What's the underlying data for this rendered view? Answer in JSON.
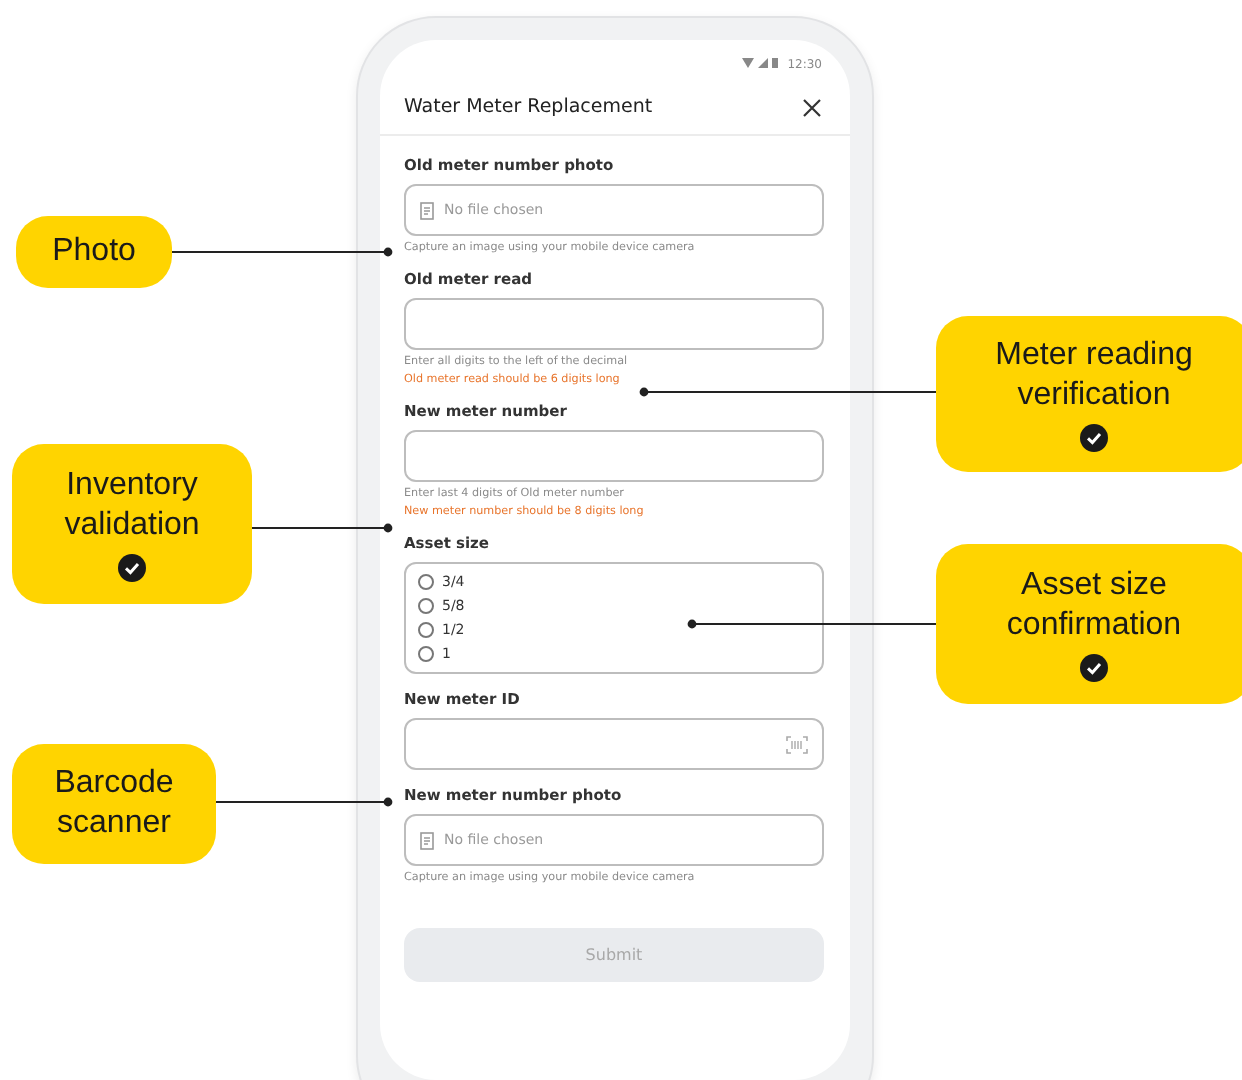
{
  "status_bar": {
    "time": "12:30"
  },
  "header": {
    "title": "Water Meter Replacement"
  },
  "fields": [
    {
      "kind": "file",
      "label": "Old meter number photo",
      "placeholder": "No file chosen",
      "hints": [
        {
          "text": "Capture an image using your mobile device camera",
          "error": false
        }
      ]
    },
    {
      "kind": "text",
      "label": "Old meter read",
      "hints": [
        {
          "text": "Enter all digits to the left of the decimal",
          "error": false
        },
        {
          "text": "Old meter read should be 6 digits long",
          "error": true
        }
      ]
    },
    {
      "kind": "text",
      "label": "New meter number",
      "hints": [
        {
          "text": "Enter last 4 digits of Old meter number",
          "error": false
        },
        {
          "text": "New meter number should be 8 digits long",
          "error": true
        }
      ]
    },
    {
      "kind": "radio",
      "label": "Asset size",
      "options": [
        {
          "label": "3/4",
          "selected": false
        },
        {
          "label": "5/8",
          "selected": false
        },
        {
          "label": "1/2",
          "selected": false
        },
        {
          "label": "1",
          "selected": false
        }
      ]
    },
    {
      "kind": "scan",
      "label": "New meter ID"
    },
    {
      "kind": "file",
      "label": "New meter number photo",
      "placeholder": "No file chosen",
      "hints": [
        {
          "text": "Capture an image using your mobile device camera",
          "error": false
        }
      ]
    }
  ],
  "submit": {
    "label": "Submit",
    "disabled": true
  },
  "callouts": [
    {
      "text": "Photo",
      "verified": false
    },
    {
      "text": "Inventory validation",
      "verified": true
    },
    {
      "text": "Barcode scanner",
      "verified": false
    },
    {
      "text": "Meter reading verification",
      "verified": true
    },
    {
      "text": "Asset size confirmation",
      "verified": true
    }
  ]
}
